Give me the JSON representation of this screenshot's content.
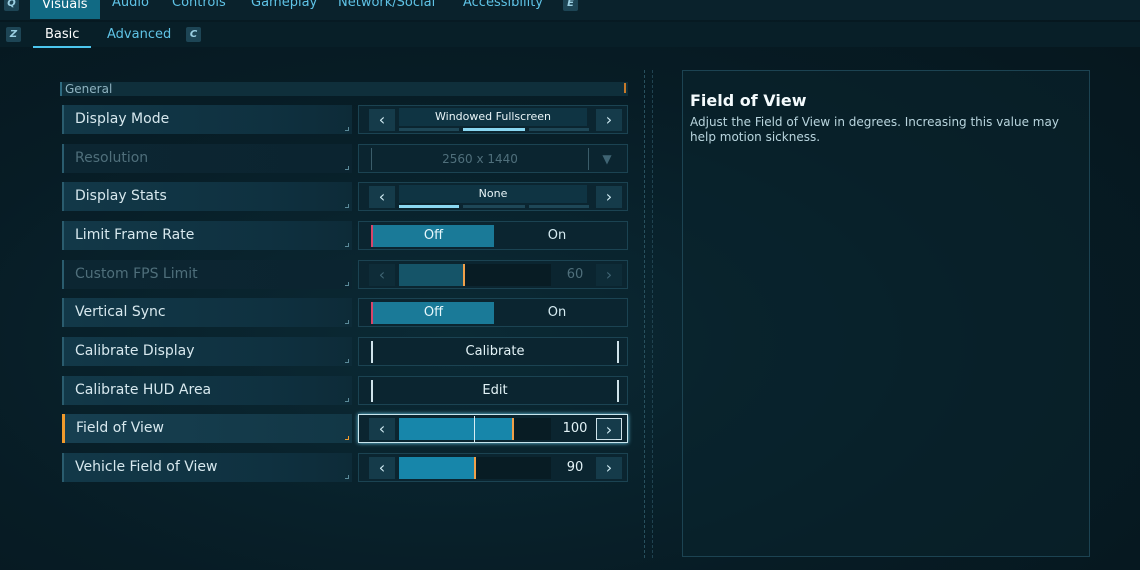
{
  "top_tabs": [
    {
      "label": "Visuals",
      "active": true
    },
    {
      "label": "Audio",
      "active": false
    },
    {
      "label": "Controls",
      "active": false
    },
    {
      "label": "Gameplay",
      "active": false
    },
    {
      "label": "Network/Social",
      "active": false
    },
    {
      "label": "Accessibility",
      "active": false
    }
  ],
  "top_keys": {
    "left": "Q",
    "right": "E"
  },
  "sub_tabs": [
    {
      "label": "Basic",
      "active": true
    },
    {
      "label": "Advanced",
      "active": false
    }
  ],
  "sub_keys": {
    "left": "Z",
    "right": "C"
  },
  "section": {
    "title": "General"
  },
  "settings": [
    {
      "label": "Display Mode",
      "type": "selector",
      "value": "Windowed Fullscreen",
      "options_count": 3,
      "selected_index": 1
    },
    {
      "label": "Resolution",
      "type": "dropdown",
      "value": "2560 x 1440",
      "disabled": true
    },
    {
      "label": "Display Stats",
      "type": "selector",
      "value": "None",
      "options_count": 3,
      "selected_index": 0
    },
    {
      "label": "Limit Frame Rate",
      "type": "toggle",
      "off_label": "Off",
      "on_label": "On",
      "value": "Off"
    },
    {
      "label": "Custom FPS Limit",
      "type": "slider",
      "value": "60",
      "fraction": 0.43,
      "disabled": true
    },
    {
      "label": "Vertical Sync",
      "type": "toggle",
      "off_label": "Off",
      "on_label": "On",
      "value": "Off"
    },
    {
      "label": "Calibrate Display",
      "type": "button",
      "button_label": "Calibrate"
    },
    {
      "label": "Calibrate HUD Area",
      "type": "button",
      "button_label": "Edit"
    },
    {
      "label": "Field of View",
      "type": "slider",
      "value": "100",
      "fraction": 0.75,
      "selected": true
    },
    {
      "label": "Vehicle Field of View",
      "type": "slider",
      "value": "90",
      "fraction": 0.5
    }
  ],
  "info_panel": {
    "title": "Field of View",
    "description": "Adjust the Field of View in degrees. Increasing this value may help motion sickness."
  },
  "colors": {
    "accent": "#1786aa",
    "highlight": "#f09a2c",
    "background": "#071c25"
  }
}
